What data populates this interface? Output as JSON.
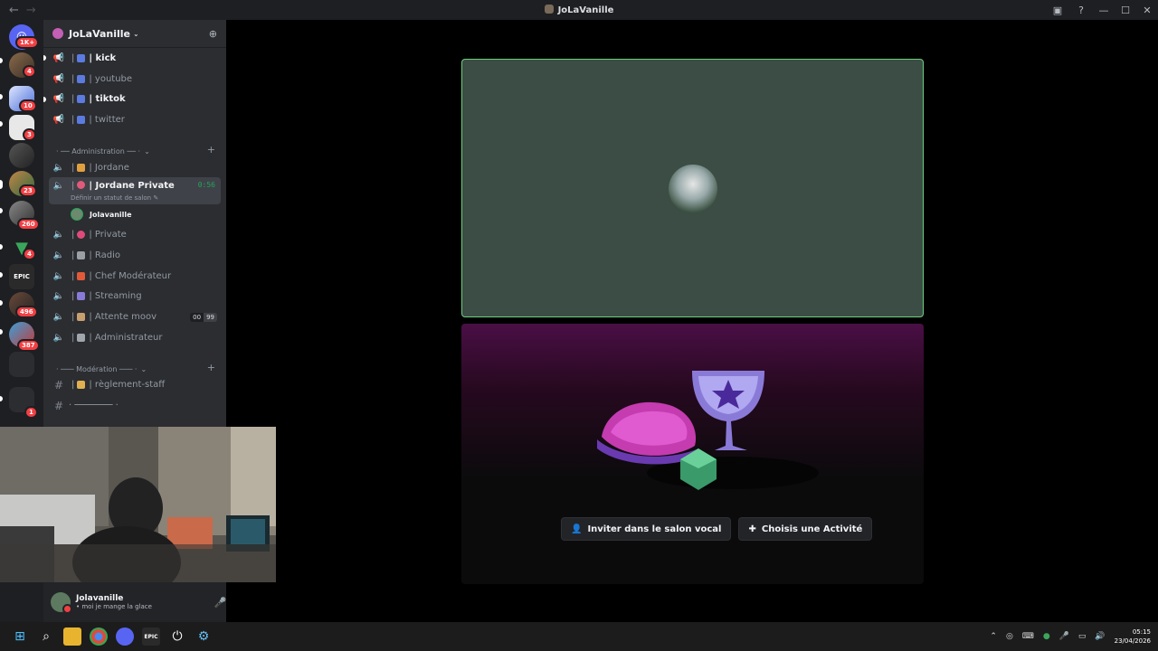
{
  "window": {
    "title": "JoLaVanille"
  },
  "guilds": {
    "items": [
      {
        "name": "direct-messages",
        "badge": "1K+"
      },
      {
        "name": "server-1",
        "badge": "4"
      },
      {
        "name": "server-2",
        "badge": "10"
      },
      {
        "name": "server-3",
        "badge": "3"
      },
      {
        "name": "server-4",
        "badge": ""
      },
      {
        "name": "server-5",
        "badge": "23"
      },
      {
        "name": "server-6",
        "badge": "260"
      },
      {
        "name": "server-7",
        "badge": "4"
      },
      {
        "name": "server-8",
        "badge": ""
      },
      {
        "name": "server-9",
        "badge": "496"
      },
      {
        "name": "server-10",
        "badge": "387"
      },
      {
        "name": "server-11",
        "badge": ""
      },
      {
        "name": "server-12",
        "badge": "1"
      }
    ]
  },
  "server": {
    "name": "JoLaVanille"
  },
  "channels": {
    "social": [
      {
        "label": "| kick",
        "unread": true
      },
      {
        "label": "| youtube",
        "unread": false
      },
      {
        "label": "| tiktok",
        "unread": true
      },
      {
        "label": "| twitter",
        "unread": false
      }
    ],
    "admin_category": "· ── Administration ── ·",
    "admin": [
      {
        "label": "| Jordane"
      }
    ],
    "active": {
      "label": "| Jordane Private",
      "timer": "0:56",
      "status_hint": "Définir un statut de salon"
    },
    "voice_user": "Jolavanille",
    "admin2": [
      {
        "label": "| Private"
      },
      {
        "label": "| Radio"
      },
      {
        "label": "| Chef Modérateur"
      },
      {
        "label": "| Streaming"
      },
      {
        "label": "| Attente moov",
        "limit_a": "00",
        "limit_b": "99"
      },
      {
        "label": "| Administrateur"
      }
    ],
    "mod_category": "· ─── Modération ─── ·",
    "mod": [
      {
        "label": "| règlement-staff"
      },
      {
        "label": "· ─────── ·"
      }
    ]
  },
  "user": {
    "name": "Jolavanille",
    "status": "• moi je mange la glace"
  },
  "activity": {
    "invite_label": "Inviter dans le salon vocal",
    "choose_label": "Choisis une Activité"
  },
  "taskbar": {
    "time": "05:15",
    "date": "23/04/2026"
  }
}
